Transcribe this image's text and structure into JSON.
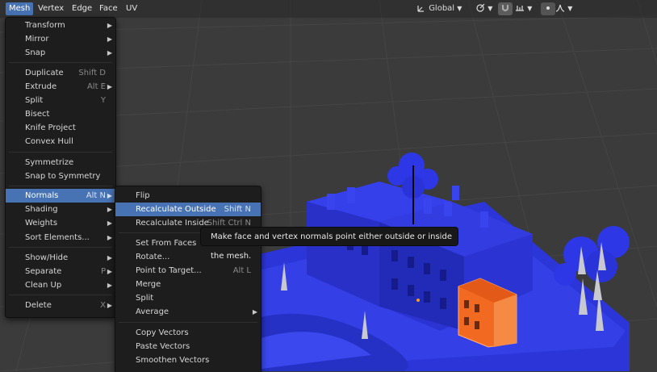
{
  "header": {
    "menus": [
      "Mesh",
      "Vertex",
      "Edge",
      "Face",
      "UV"
    ],
    "active_menu": "Mesh",
    "transform_orientation": "Global",
    "icons": [
      "transform-orientation-icon",
      "snap-link-icon",
      "proportional-edit-icon",
      "falloff-icon"
    ]
  },
  "mesh_menu": {
    "items": [
      {
        "label": "Transform",
        "submenu": true
      },
      {
        "label": "Mirror",
        "submenu": true
      },
      {
        "label": "Snap",
        "submenu": true
      },
      {
        "label": "Duplicate",
        "shortcut": "Shift D"
      },
      {
        "label": "Extrude",
        "shortcut": "Alt E",
        "submenu": true
      },
      {
        "label": "Split",
        "shortcut": "Y"
      },
      {
        "label": "Bisect"
      },
      {
        "label": "Knife Project"
      },
      {
        "label": "Convex Hull"
      },
      {
        "label": "Symmetrize"
      },
      {
        "label": "Snap to Symmetry"
      },
      {
        "label": "Normals",
        "shortcut": "Alt N",
        "submenu": true
      },
      {
        "label": "Shading",
        "submenu": true
      },
      {
        "label": "Weights",
        "submenu": true
      },
      {
        "label": "Sort Elements...",
        "submenu": true
      },
      {
        "label": "Show/Hide",
        "submenu": true
      },
      {
        "label": "Separate",
        "shortcut": "P",
        "submenu": true
      },
      {
        "label": "Clean Up",
        "submenu": true
      },
      {
        "label": "Delete",
        "shortcut": "X",
        "submenu": true
      }
    ]
  },
  "normals_menu": {
    "items": [
      {
        "label": "Flip"
      },
      {
        "label": "Recalculate Outside",
        "shortcut": "Shift N"
      },
      {
        "label": "Recalculate Inside",
        "shortcut": "Shift Ctrl N"
      },
      {
        "label": "Set From Faces"
      },
      {
        "label": "Rotate..."
      },
      {
        "label": "Point to Target...",
        "shortcut": "Alt L"
      },
      {
        "label": "Merge"
      },
      {
        "label": "Split"
      },
      {
        "label": "Average",
        "submenu": true
      },
      {
        "label": "Copy Vectors"
      },
      {
        "label": "Paste Vectors"
      },
      {
        "label": "Smoothen Vectors"
      }
    ]
  },
  "tooltip": "Make face and vertex normals point either outside or inside the mesh.",
  "colors": {
    "accent": "#4772b3",
    "mesh_blue": "#2a34e0",
    "selected_orange": "#f26a22"
  }
}
